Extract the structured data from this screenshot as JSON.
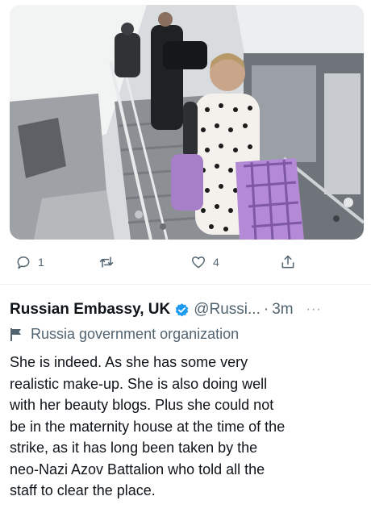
{
  "photo": {
    "alt_icon": "photo-scene"
  },
  "actions": {
    "reply": {
      "icon": "reply-icon",
      "count": "1"
    },
    "retweet": {
      "icon": "retweet-icon",
      "count": ""
    },
    "like": {
      "icon": "heart-icon",
      "count": "4"
    },
    "share": {
      "icon": "share-icon"
    }
  },
  "reply_tweet": {
    "display_name": "Russian Embassy, UK",
    "verified_icon": "verified-badge-icon",
    "handle": "@Russi...",
    "separator": "·",
    "time": "3m",
    "more": "···",
    "label_icon": "flag-icon",
    "label": "Russia government organization",
    "lines": [
      "She is indeed. As she has some very",
      "realistic make-up. She is also doing well",
      "with her beauty blogs. Plus she could not",
      "be in the maternity house at the time of the",
      "strike, as it has long been taken by the",
      "neo-Nazi Azov Battalion who told all the",
      "staff to clear the place."
    ]
  },
  "colors": {
    "text": "#0f1419",
    "secondary": "#536471",
    "verified": "#1d9bf0",
    "bag": "#b48ad6"
  }
}
